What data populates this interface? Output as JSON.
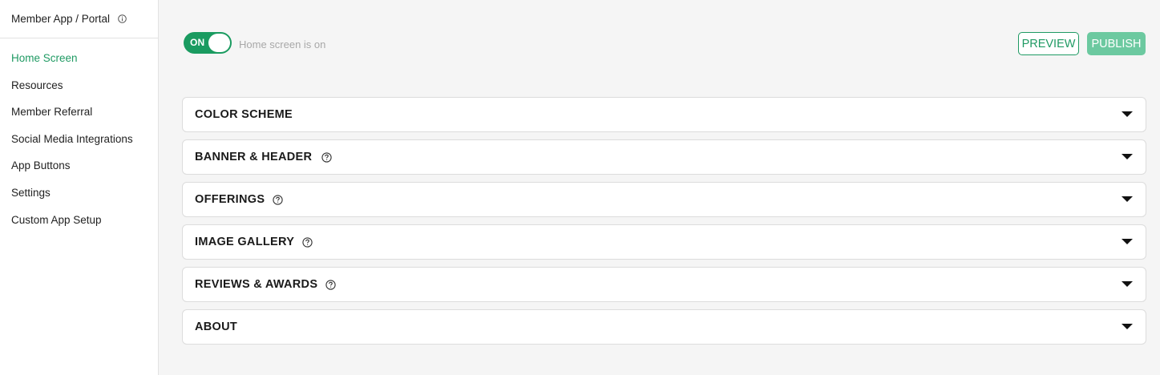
{
  "sidebar": {
    "title": "Member App / Portal",
    "items": [
      {
        "label": "Home Screen",
        "active": true
      },
      {
        "label": "Resources"
      },
      {
        "label": "Member Referral"
      },
      {
        "label": "Social Media Integrations"
      },
      {
        "label": "App Buttons"
      },
      {
        "label": "Settings"
      },
      {
        "label": "Custom App Setup"
      }
    ]
  },
  "header": {
    "toggle_label": "ON",
    "toggle_status": "Home screen is on",
    "preview_label": "PREVIEW",
    "publish_label": "PUBLISH"
  },
  "sections": [
    {
      "title": "COLOR SCHEME"
    },
    {
      "title": "BANNER & HEADER"
    },
    {
      "title": "OFFERINGS"
    },
    {
      "title": "IMAGE GALLERY"
    },
    {
      "title": "REVIEWS & AWARDS"
    },
    {
      "title": "ABOUT"
    }
  ],
  "colors": {
    "accent": "#1f9a63",
    "toggle_on": "#1a9b60",
    "publish_bg": "#6cc9a0",
    "background": "#f5f5f5"
  }
}
